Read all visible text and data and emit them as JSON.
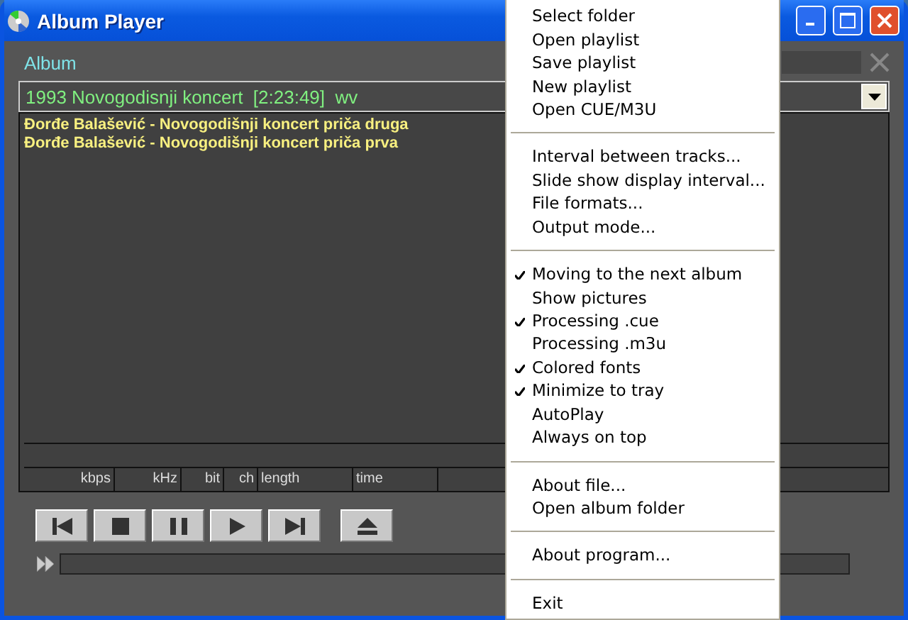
{
  "window": {
    "title": "Album Player"
  },
  "album_label": "Album",
  "album_select": {
    "value": "1993 Novogodisnji koncert  [2:23:49]  wv"
  },
  "tracks": [
    {
      "title": "Đorđe Balašević - Novogodišnji koncert priča druga"
    },
    {
      "title": "Đorđe Balašević - Novogodišnji koncert priča prva"
    }
  ],
  "info_columns": [
    "kbps",
    "kHz",
    "bit",
    "ch",
    "length",
    "time"
  ],
  "controls": [
    {
      "kind": "previous"
    },
    {
      "kind": "stop"
    },
    {
      "kind": "pause"
    },
    {
      "kind": "play"
    },
    {
      "kind": "next"
    },
    {
      "kind": "eject"
    }
  ],
  "progress": {
    "level": 0
  },
  "menu": [
    [
      {
        "label": "Select folder",
        "kind": "command"
      },
      {
        "label": "Open playlist",
        "kind": "command"
      },
      {
        "label": "Save playlist",
        "kind": "command"
      },
      {
        "label": "New playlist",
        "kind": "command"
      },
      {
        "label": "Open CUE/M3U",
        "kind": "command"
      }
    ],
    [
      {
        "label": "Interval between tracks...",
        "kind": "command"
      },
      {
        "label": "Slide show display interval...",
        "kind": "command"
      },
      {
        "label": "File formats...",
        "kind": "command"
      },
      {
        "label": "Output mode...",
        "kind": "command"
      }
    ],
    [
      {
        "label": "Moving to the next album",
        "kind": "check",
        "checked": true
      },
      {
        "label": "Show pictures",
        "kind": "check",
        "checked": false
      },
      {
        "label": "Processing .cue",
        "kind": "check",
        "checked": true
      },
      {
        "label": "Processing .m3u",
        "kind": "check",
        "checked": false
      },
      {
        "label": "Colored fonts",
        "kind": "check",
        "checked": true
      },
      {
        "label": "Minimize to tray",
        "kind": "check",
        "checked": true
      },
      {
        "label": "AutoPlay",
        "kind": "check",
        "checked": false
      },
      {
        "label": "Always on top",
        "kind": "check",
        "checked": false
      }
    ],
    [
      {
        "label": "About file...",
        "kind": "command"
      },
      {
        "label": "Open album folder",
        "kind": "command"
      }
    ],
    [
      {
        "label": "About program...",
        "kind": "command"
      }
    ],
    [
      {
        "label": "Exit",
        "kind": "command"
      }
    ]
  ]
}
